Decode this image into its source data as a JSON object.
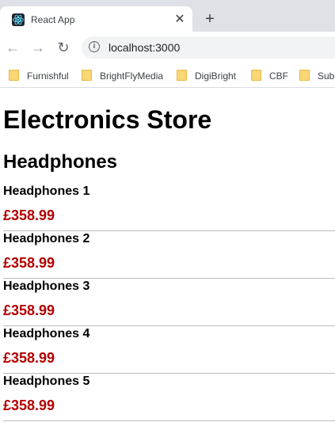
{
  "browser": {
    "tab_title": "React App",
    "tab_close": "✕",
    "new_tab": "+",
    "nav_back": "←",
    "nav_forward": "→",
    "nav_reload": "↻",
    "info": "i",
    "url": "localhost:3000",
    "bookmarks": [
      {
        "label": "Furnishful"
      },
      {
        "label": "BrightFlyMedia"
      },
      {
        "label": "DigiBright"
      },
      {
        "label": "CBF"
      },
      {
        "label": "Subs"
      }
    ]
  },
  "page": {
    "store_title": "Electronics Store",
    "category_title": "Headphones",
    "products": [
      {
        "name": "Headphones 1",
        "price": "£358.99"
      },
      {
        "name": "Headphones 2",
        "price": "£358.99"
      },
      {
        "name": "Headphones 3",
        "price": "£358.99"
      },
      {
        "name": "Headphones 4",
        "price": "£358.99"
      },
      {
        "name": "Headphones 5",
        "price": "£358.99"
      }
    ]
  },
  "colors": {
    "price": "#b30000",
    "tabstrip": "#dee1e6",
    "omnibox": "#f1f3f4"
  }
}
